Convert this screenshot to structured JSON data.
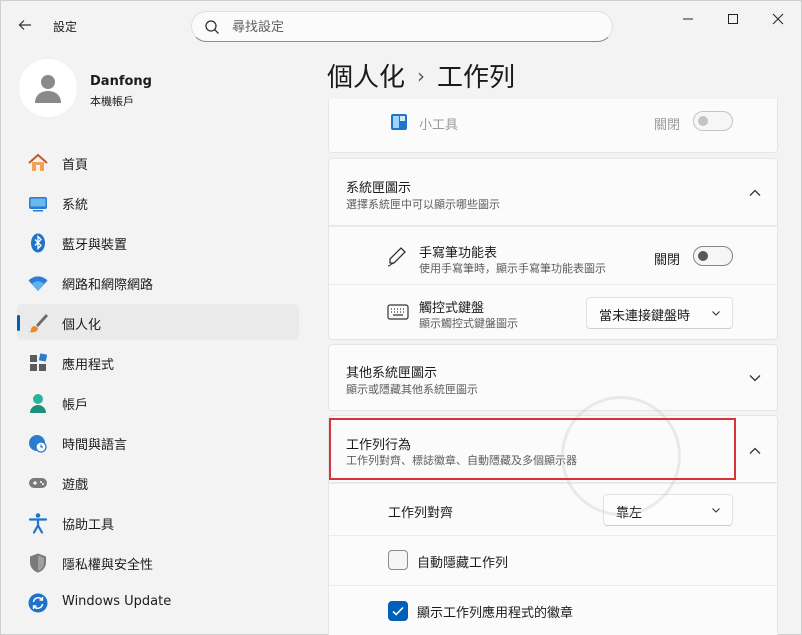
{
  "window": {
    "app_title": "設定",
    "controls": [
      "minimize",
      "maximize",
      "close"
    ]
  },
  "search": {
    "placeholder": "尋找設定"
  },
  "profile": {
    "name": "Danfong",
    "subtitle": "本機帳戶"
  },
  "sidebar": {
    "items": [
      {
        "label": "首頁",
        "icon": "home-icon"
      },
      {
        "label": "系統",
        "icon": "system-icon"
      },
      {
        "label": "藍牙與裝置",
        "icon": "bluetooth-icon"
      },
      {
        "label": "網路和網際網路",
        "icon": "wifi-icon"
      },
      {
        "label": "個人化",
        "icon": "brush-icon",
        "active": true
      },
      {
        "label": "應用程式",
        "icon": "apps-icon"
      },
      {
        "label": "帳戶",
        "icon": "account-icon"
      },
      {
        "label": "時間與語言",
        "icon": "clock-globe-icon"
      },
      {
        "label": "遊戲",
        "icon": "gamepad-icon"
      },
      {
        "label": "協助工具",
        "icon": "accessibility-icon"
      },
      {
        "label": "隱私權與安全性",
        "icon": "shield-icon"
      },
      {
        "label": "Windows Update",
        "icon": "update-icon"
      }
    ]
  },
  "breadcrumb": {
    "parent": "個人化",
    "separator": "›",
    "current": "工作列"
  },
  "widgets_row": {
    "label": "小工具",
    "state": "關閉"
  },
  "system_tray": {
    "title": "系統匣圖示",
    "desc": "選擇系統匣中可以顯示哪些圖示",
    "pen_menu": {
      "title": "手寫筆功能表",
      "desc": "使用手寫筆時，顯示手寫筆功能表圖示",
      "state": "關閉"
    },
    "touch_keyboard": {
      "title": "觸控式鍵盤",
      "desc": "顯示觸控式鍵盤圖示",
      "value": "當未連接鍵盤時"
    }
  },
  "other_tray": {
    "title": "其他系統匣圖示",
    "desc": "顯示或隱藏其他系統匣圖示"
  },
  "behaviors": {
    "title": "工作列行為",
    "desc": "工作列對齊、標誌徽章、自動隱藏及多個顯示器",
    "alignment": {
      "label": "工作列對齊",
      "value": "靠左"
    },
    "auto_hide": {
      "label": "自動隱藏工作列",
      "checked": false
    },
    "badges": {
      "label": "顯示工作列應用程式的徽章",
      "checked": true
    }
  },
  "colors": {
    "accent": "#005fb8",
    "highlight": "#d9333a"
  }
}
